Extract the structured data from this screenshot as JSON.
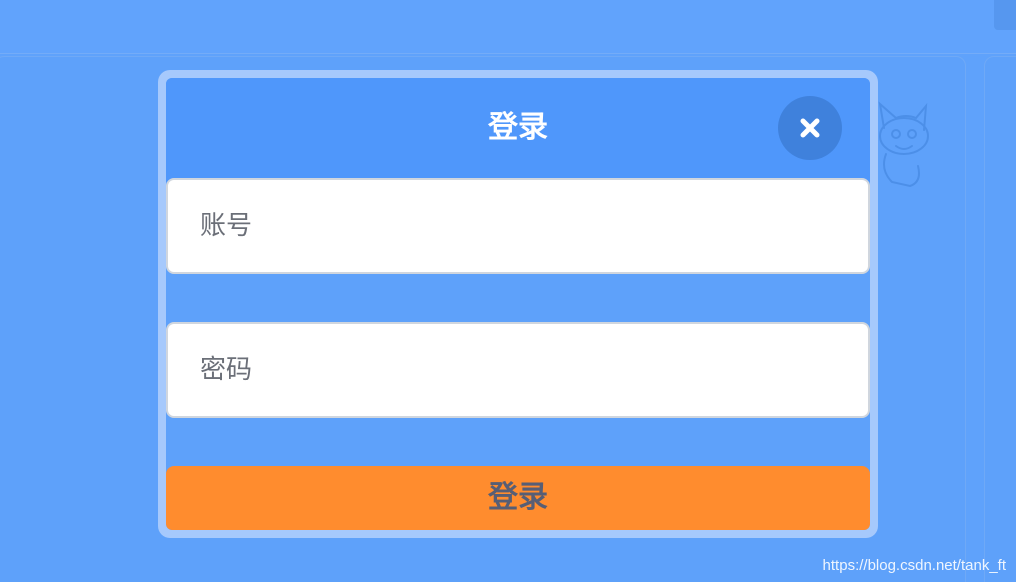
{
  "colors": {
    "background": "#5fa2fb",
    "modal_frame": "#a6c9fc",
    "modal_header": "#4f97fb",
    "close_button": "#3f81dc",
    "submit_button": "#ff8c2e",
    "submit_text": "#575e75"
  },
  "modal": {
    "title": "登录",
    "close_icon": "close-icon",
    "username": {
      "value": "",
      "placeholder": "账号"
    },
    "password": {
      "value": "",
      "placeholder": "密码"
    },
    "submit_label": "登录"
  },
  "watermark": "https://blog.csdn.net/tank_ft"
}
